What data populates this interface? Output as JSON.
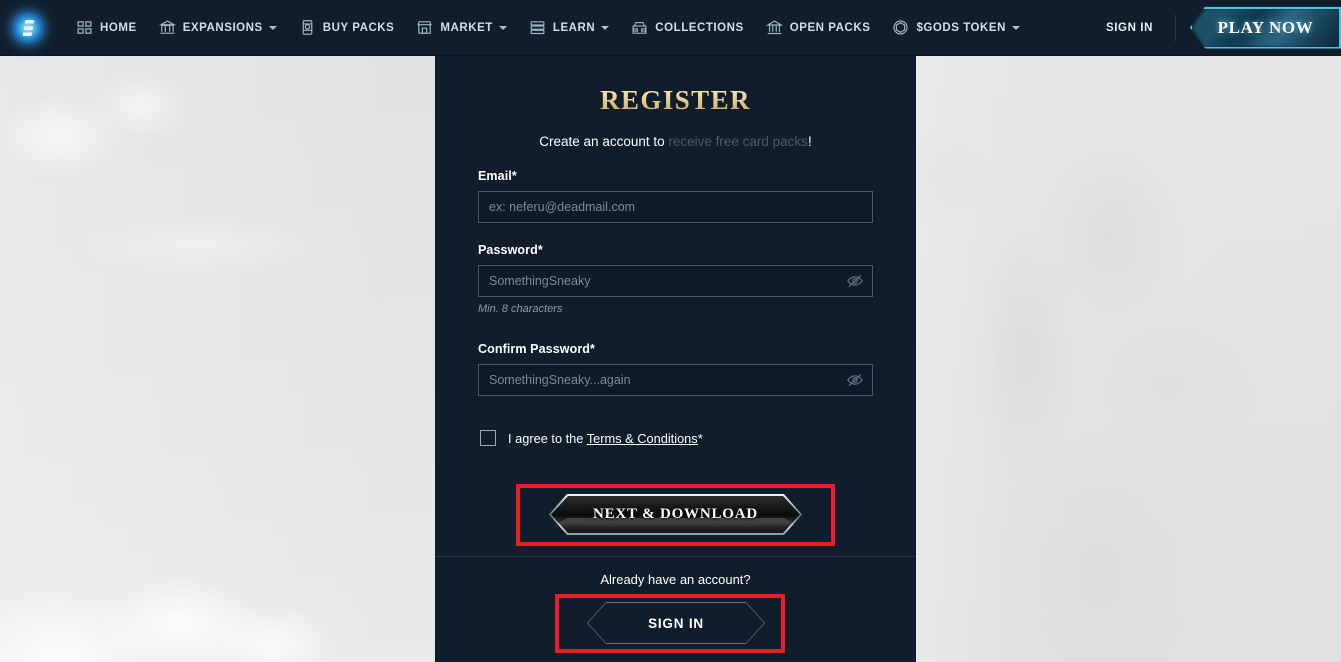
{
  "nav": {
    "logo_icon": "gods-unchained-logo-icon",
    "items": [
      {
        "label": "HOME",
        "icon": "grid-cards-icon",
        "has_caret": false
      },
      {
        "label": "EXPANSIONS",
        "icon": "museum-building-icon",
        "has_caret": true
      },
      {
        "label": "BUY PACKS",
        "icon": "card-pack-icon",
        "has_caret": false
      },
      {
        "label": "MARKET",
        "icon": "market-stall-icon",
        "has_caret": true
      },
      {
        "label": "LEARN",
        "icon": "book-stack-icon",
        "has_caret": true
      },
      {
        "label": "COLLECTIONS",
        "icon": "collection-box-icon",
        "has_caret": false
      },
      {
        "label": "OPEN PACKS",
        "icon": "bank-columns-icon",
        "has_caret": false
      },
      {
        "label": "$GODS TOKEN",
        "icon": "token-coin-icon",
        "has_caret": true
      }
    ],
    "sign_in_label": "SIGN IN",
    "play_now_label": "PLAY NOW"
  },
  "form": {
    "title": "REGISTER",
    "subtitle_prefix": "Create an account to ",
    "subtitle_highlight": "receive free card packs",
    "subtitle_suffix": "!",
    "email": {
      "label": "Email*",
      "placeholder": "ex: neferu@deadmail.com",
      "value": ""
    },
    "password": {
      "label": "Password*",
      "placeholder": "SomethingSneaky",
      "value": "",
      "hint": "Min. 8 characters",
      "toggle_icon": "eye-off-icon"
    },
    "confirm_password": {
      "label": "Confirm Password*",
      "placeholder": "SomethingSneaky...again",
      "value": "",
      "toggle_icon": "eye-off-icon"
    },
    "terms": {
      "prefix": "I agree to the ",
      "link": "Terms & Conditions",
      "suffix": "*",
      "checked": false
    },
    "submit_label": "NEXT & DOWNLOAD"
  },
  "footer": {
    "already_text": "Already have an account?",
    "sign_in_label": "SIGN IN"
  },
  "colors": {
    "panel_bg": "#101d2b",
    "nav_bg": "#101d2b",
    "accent_gold": "#e9cf96",
    "accent_cyan": "#49c4e3",
    "annotation_red": "#ef1c26",
    "input_border": "#46586c"
  }
}
